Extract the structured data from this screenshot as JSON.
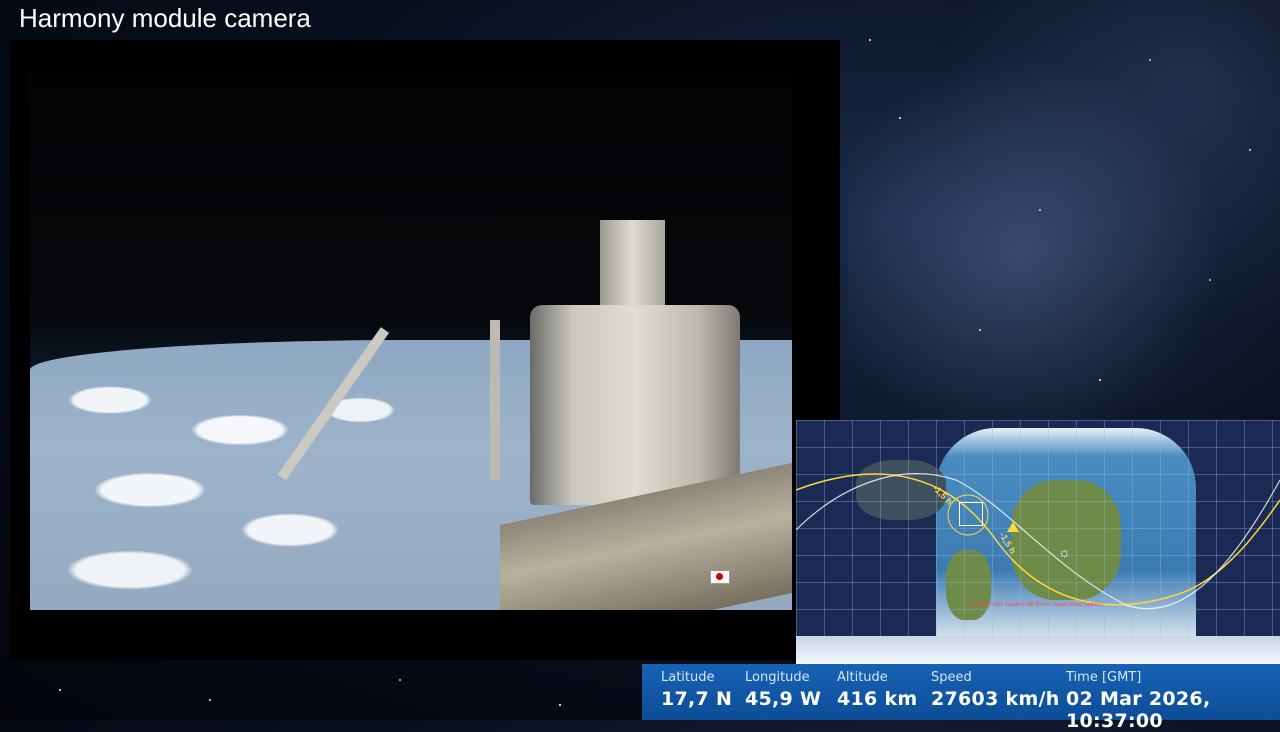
{
  "stream": {
    "title": "Harmony module camera"
  },
  "tracker": {
    "track_labels": [
      "-1,5 h",
      "-1,5 h"
    ],
    "map_note": "Predicted track variation with 90 min. transit period (approx.)",
    "info": [
      {
        "label": "Latitude",
        "value": "17,7 N"
      },
      {
        "label": "Longitude",
        "value": "45,9 W"
      },
      {
        "label": "Altitude",
        "value": "416 km"
      },
      {
        "label": "Speed",
        "value": "27603 km/h"
      },
      {
        "label": "Time [GMT]",
        "value": "02 Mar 2026, 10:37:00"
      }
    ]
  },
  "colors": {
    "info_bar": "#1762b5",
    "track_yellow": "#ffd83a",
    "night_map": "#1b2a55"
  }
}
